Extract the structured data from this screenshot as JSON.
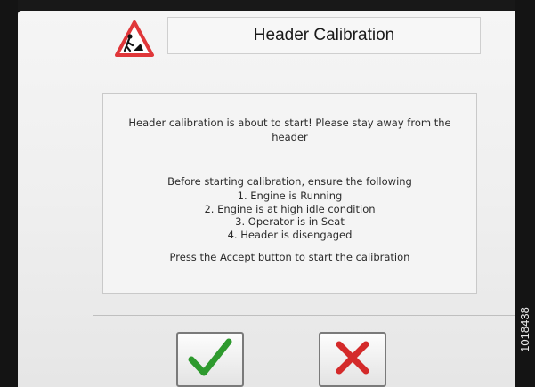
{
  "dialog": {
    "title": "Header Calibration",
    "warning_icon": "warning-worker-icon",
    "message": {
      "intro": "Header calibration is about to start! Please stay away from the header",
      "before": "Before starting calibration, ensure the following",
      "steps": [
        "1. Engine is Running",
        "2. Engine is at high idle condition",
        "3. Operator is in Seat",
        "4. Header is disengaged"
      ],
      "instruction": "Press the Accept button to start the calibration"
    }
  },
  "buttons": {
    "accept_icon": "checkmark-icon",
    "cancel_icon": "x-cancel-icon"
  },
  "figure_id": "1018438",
  "colors": {
    "warning_red": "#e0373a",
    "accept_green": "#2e9a2e",
    "cancel_red": "#d42a2a"
  }
}
